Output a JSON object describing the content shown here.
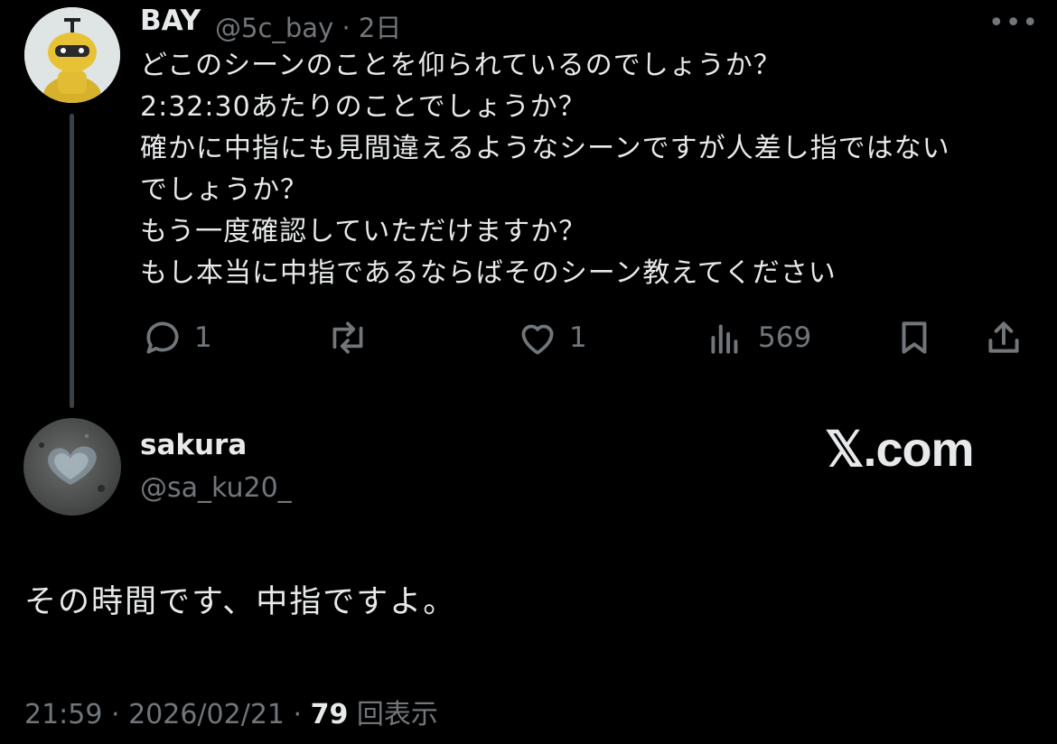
{
  "tweet1": {
    "display_name": "BAY",
    "handle": "@5c_bay",
    "time": "2日",
    "lines": [
      "どこのシーンのことを仰られているのでしょうか？",
      "2:32:30あたりのことでしょうか？",
      "確かに中指にも見間違えるようなシーンですが人差し指ではない",
      "でしょうか？",
      "もう一度確認していただけますか？",
      "もし本当に中指であるならばそのシーン教えてください"
    ],
    "actions": {
      "reply_count": "1",
      "like_count": "1",
      "view_count": "569"
    }
  },
  "tweet2": {
    "display_name": "sakura",
    "handle": "@sa_ku20_",
    "text": "その時間です、中指ですよ。",
    "time": "21:59",
    "date": "2026/02/21",
    "views": "79",
    "views_label": "回表示"
  },
  "watermark": "𝕏.com",
  "colors": {
    "background": "#000000",
    "text": "#e7e9ea",
    "muted": "#71767b"
  }
}
